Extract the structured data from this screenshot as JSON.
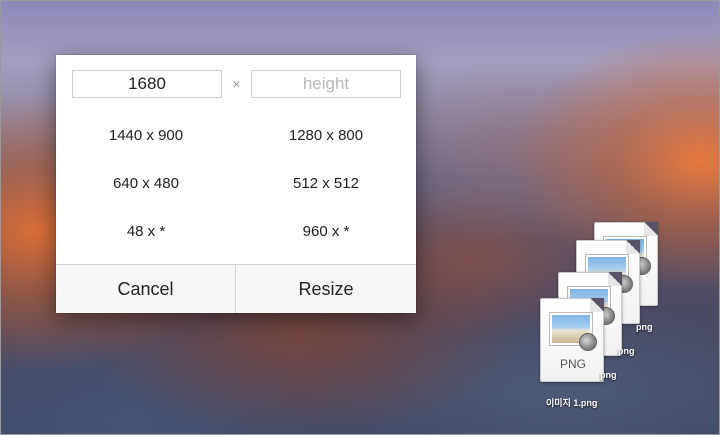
{
  "dialog": {
    "width_input": {
      "value": "1680",
      "placeholder": "width"
    },
    "times_sign": "×",
    "height_input": {
      "value": "",
      "placeholder": "height"
    },
    "presets": [
      "1440 x 900",
      "1280 x 800",
      "640 x 480",
      "512 x 512",
      "48 x *",
      "960 x *"
    ],
    "cancel_label": "Cancel",
    "resize_label": "Resize"
  },
  "desktop": {
    "file_type_label": "PNG",
    "file_names": [
      "이미지 1.png",
      "png",
      "png",
      "png"
    ]
  }
}
